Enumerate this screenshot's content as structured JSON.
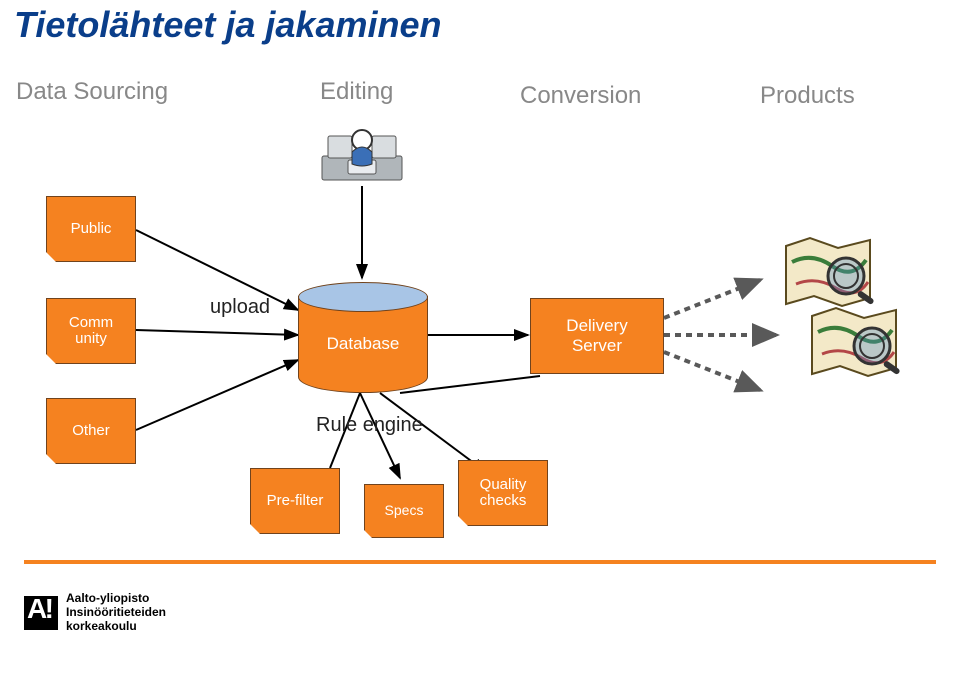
{
  "title": "Tietolähteet ja jakaminen",
  "columns": {
    "data_sourcing": "Data Sourcing",
    "editing": "Editing",
    "conversion": "Conversion",
    "products": "Products"
  },
  "notes": {
    "public": "Public",
    "community_line1": "Comm",
    "community_line2": "unity",
    "other": "Other",
    "prefilter": "Pre-filter",
    "specs": "Specs",
    "quality_line1": "Quality",
    "quality_line2": "checks"
  },
  "labels": {
    "upload": "upload",
    "database": "Database",
    "delivery_line1": "Delivery",
    "delivery_line2": "Server",
    "rule_engine": "Rule engine"
  },
  "footer": {
    "brand": "Aalto-yliopisto",
    "school_line1": "Insinööritieteiden",
    "school_line2": "korkeakoulu"
  },
  "colors": {
    "title": "#0a3e8a",
    "accent": "#f58220",
    "border": "#70431d",
    "grey": "#888888"
  }
}
